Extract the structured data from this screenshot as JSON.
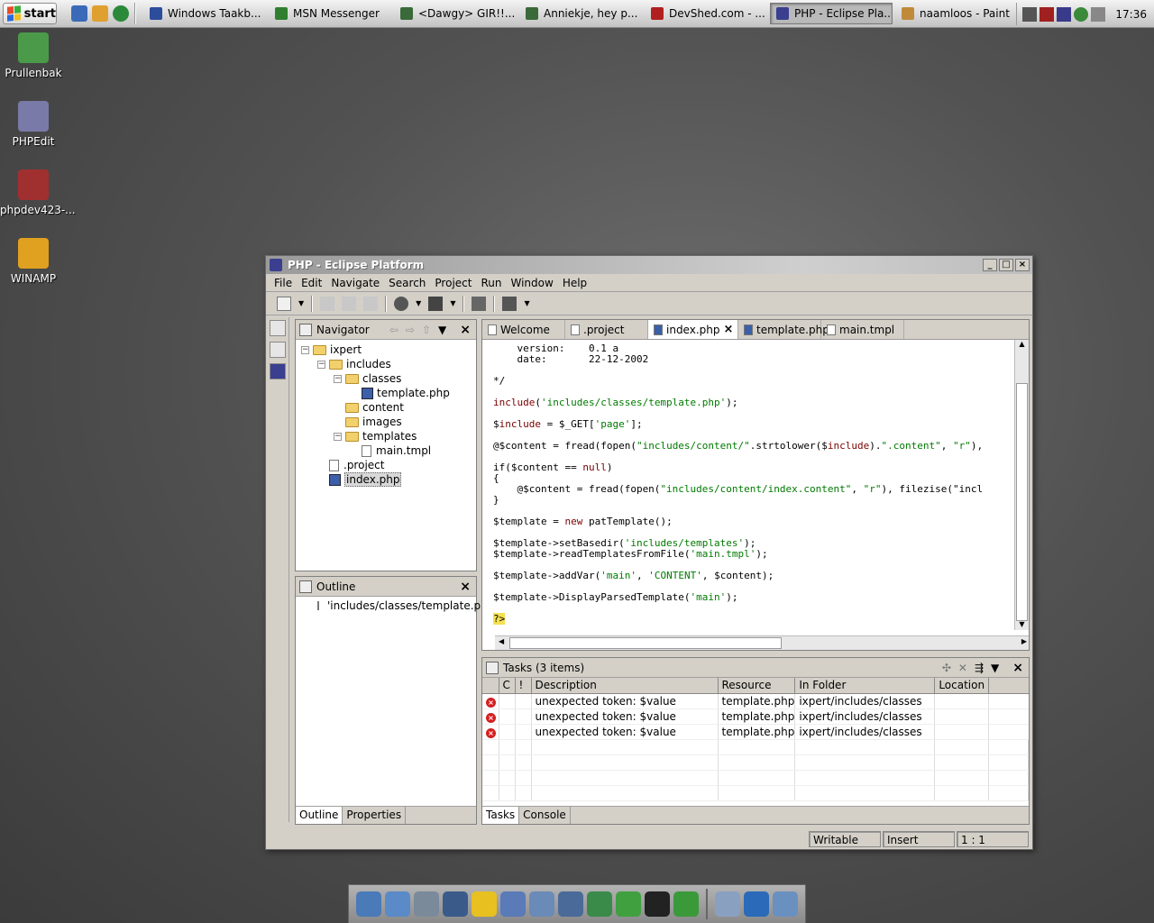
{
  "taskbar": {
    "start_label": "start",
    "tasks": [
      {
        "label": "Windows Taakb...",
        "color": "#2c4c9c"
      },
      {
        "label": "MSN Messenger",
        "color": "#2f7f2f"
      },
      {
        "label": "<Dawgy> GIR!!...",
        "color": "#3a6a3a"
      },
      {
        "label": "Anniekje, hey p...",
        "color": "#3a6a3a"
      },
      {
        "label": "DevShed.com - ...",
        "color": "#b02020"
      },
      {
        "label": "PHP - Eclipse Pla...",
        "color": "#3b3f8f"
      },
      {
        "label": "naamloos - Paint",
        "color": "#c08a3a"
      }
    ],
    "clock": "17:36"
  },
  "desktop": {
    "icons": [
      {
        "label": "Prullenbak",
        "color": "#4a9a4a"
      },
      {
        "label": "PHPEdit",
        "color": "#7a7aa8"
      },
      {
        "label": "phpdev423-...",
        "color": "#a03030"
      },
      {
        "label": "WINAMP",
        "color": "#e0a020"
      }
    ]
  },
  "eclipse": {
    "title": "PHP - Eclipse Platform",
    "menu": [
      "File",
      "Edit",
      "Navigate",
      "Search",
      "Project",
      "Run",
      "Window",
      "Help"
    ],
    "navigator": {
      "title": "Navigator",
      "tree": [
        {
          "label": "ixpert",
          "depth": 0,
          "kind": "folder",
          "toggle": "−"
        },
        {
          "label": "includes",
          "depth": 1,
          "kind": "folder",
          "toggle": "−"
        },
        {
          "label": "classes",
          "depth": 2,
          "kind": "folder",
          "toggle": "−"
        },
        {
          "label": "template.php",
          "depth": 3,
          "kind": "php",
          "toggle": ""
        },
        {
          "label": "content",
          "depth": 2,
          "kind": "folder",
          "toggle": ""
        },
        {
          "label": "images",
          "depth": 2,
          "kind": "folder",
          "toggle": ""
        },
        {
          "label": "templates",
          "depth": 2,
          "kind": "folder",
          "toggle": "−"
        },
        {
          "label": "main.tmpl",
          "depth": 3,
          "kind": "file",
          "toggle": ""
        },
        {
          "label": ".project",
          "depth": 1,
          "kind": "file",
          "toggle": ""
        },
        {
          "label": "index.php",
          "depth": 1,
          "kind": "php",
          "toggle": "",
          "selected": true
        }
      ]
    },
    "outline": {
      "title": "Outline",
      "item": "'includes/classes/template.php'",
      "tabs": [
        "Outline",
        "Properties"
      ]
    },
    "editor": {
      "tabs": [
        {
          "label": "Welcome",
          "kind": "file"
        },
        {
          "label": ".project",
          "kind": "file"
        },
        {
          "label": "index.php",
          "kind": "php",
          "active": true
        },
        {
          "label": "template.php",
          "kind": "php"
        },
        {
          "label": "main.tmpl",
          "kind": "file"
        }
      ],
      "code_lines": [
        "    version:    0.1 a",
        "    date:       22-12-2002",
        "",
        "*/",
        "",
        "include('includes/classes/template.php');",
        "",
        "$include = $_GET['page'];",
        "",
        "@$content = fread(fopen(\"includes/content/\".strtolower($include).\".content\", \"r\"),",
        "",
        "if($content == null)",
        "{",
        "    @$content = fread(fopen(\"includes/content/index.content\", \"r\"), filezise(\"incl",
        "}",
        "",
        "$template = new patTemplate();",
        "",
        "$template->setBasedir('includes/templates');",
        "$template->readTemplatesFromFile('main.tmpl');",
        "",
        "$template->addVar('main', 'CONTENT', $content);",
        "",
        "$template->DisplayParsedTemplate('main');",
        "",
        "?>"
      ]
    },
    "tasks": {
      "title": "Tasks (3 items)",
      "columns": [
        "C",
        "!",
        "Description",
        "Resource",
        "In Folder",
        "Location"
      ],
      "rows": [
        {
          "description": "unexpected token: $value",
          "resource": "template.php",
          "folder": "ixpert/includes/classes",
          "location": ""
        },
        {
          "description": "unexpected token: $value",
          "resource": "template.php",
          "folder": "ixpert/includes/classes",
          "location": ""
        },
        {
          "description": "unexpected token: $value",
          "resource": "template.php",
          "folder": "ixpert/includes/classes",
          "location": ""
        }
      ],
      "tabs": [
        "Tasks",
        "Console"
      ]
    },
    "status": [
      "Writable",
      "Insert",
      "1 : 1"
    ]
  },
  "dock": {
    "colors": [
      "#4a7ab8",
      "#5a8ac8",
      "#7a8a9a",
      "#3a5a8a",
      "#e8c020",
      "#5a7ab8",
      "#6a8ab8",
      "#4a6a9a",
      "#3a8a4a",
      "#40a040",
      "#222222",
      "#3a9a3a",
      "#8aa0c0",
      "#2a6ab8",
      "#6a90c0"
    ]
  }
}
